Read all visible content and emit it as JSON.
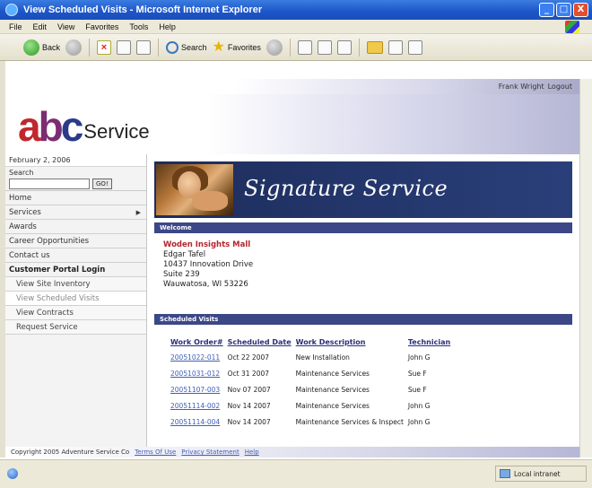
{
  "window": {
    "title": "View Scheduled Visits - Microsoft Internet Explorer",
    "controls": [
      "_",
      "□",
      "X"
    ]
  },
  "menu": [
    "File",
    "Edit",
    "View",
    "Favorites",
    "Tools",
    "Help"
  ],
  "toolbar": {
    "back": "Back",
    "search": "Search",
    "favorites": "Favorites"
  },
  "header": {
    "user": "Frank Wright",
    "logout": "Logout"
  },
  "logo": {
    "a": "a",
    "b": "b",
    "c": "c",
    "service": "Service"
  },
  "sidebar": {
    "date": "February 2, 2006",
    "search_label": "Search",
    "search_value": "",
    "go": "GO!",
    "items": [
      {
        "label": "Home"
      },
      {
        "label": "Services"
      },
      {
        "label": "Awards"
      },
      {
        "label": "Career Opportunities"
      },
      {
        "label": "Contact us"
      },
      {
        "label": "Customer Portal Login"
      },
      {
        "label": "View Site Inventory"
      },
      {
        "label": "View Scheduled Visits"
      },
      {
        "label": "View Contracts"
      },
      {
        "label": "Request Service"
      }
    ]
  },
  "banner": {
    "title": "Signature Service"
  },
  "welcome": {
    "header": "Welcome",
    "company": "Woden Insights Mall",
    "name": "Edgar Tafel",
    "street": "10437 Innovation Drive",
    "suite": "Suite 239",
    "city": "Wauwatosa, WI 53226"
  },
  "visits": {
    "header": "Scheduled Visits",
    "columns": [
      "Work Order#",
      "Scheduled Date",
      "Work Description",
      "Technician"
    ],
    "rows": [
      {
        "order": "20051022-011",
        "date": "Oct 22 2007",
        "desc": "New Installation",
        "tech": "John G"
      },
      {
        "order": "20051031-012",
        "date": "Oct 31 2007",
        "desc": "Maintenance Services",
        "tech": "Sue F"
      },
      {
        "order": "20051107-003",
        "date": "Nov 07 2007",
        "desc": "Maintenance Services",
        "tech": "Sue F"
      },
      {
        "order": "20051114-002",
        "date": "Nov 14 2007",
        "desc": "Maintenance Services",
        "tech": "John G"
      },
      {
        "order": "20051114-004",
        "date": "Nov 14 2007",
        "desc": "Maintenance Services & Inspect",
        "tech": "John G"
      }
    ]
  },
  "footer": {
    "copyright": "Copyright 2005 Adventure Service Co",
    "terms": "Terms Of Use",
    "privacy": "Privacy Statement",
    "help": "Help"
  },
  "status": {
    "zone": "Local intranet"
  }
}
